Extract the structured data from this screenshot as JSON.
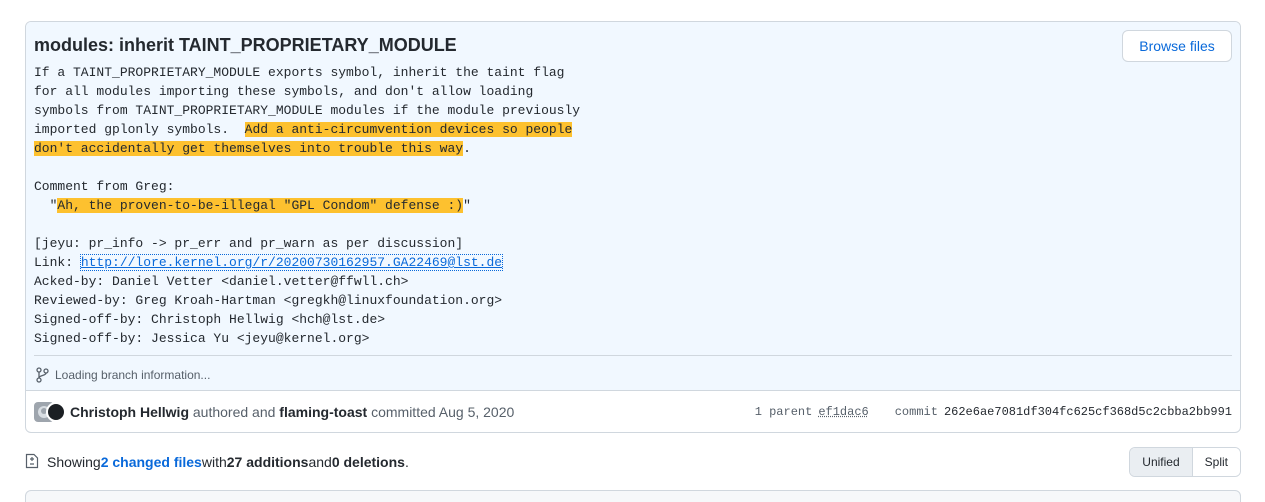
{
  "commit": {
    "title": "modules: inherit TAINT_PROPRIETARY_MODULE",
    "browse_files_label": "Browse files",
    "desc": {
      "l1": "If a TAINT_PROPRIETARY_MODULE exports symbol, inherit the taint flag",
      "l2": "for all modules importing these symbols, and don't allow loading",
      "l3": "symbols from TAINT_PROPRIETARY_MODULE modules if the module previously",
      "l4a": "imported gplonly symbols.  ",
      "l4b": "Add a anti-circumvention devices so people",
      "l5a": "don't accidentally get themselves into trouble this way",
      "l5b": ".",
      "l7": "Comment from Greg:",
      "l8a": "  \"",
      "l8b": "Ah, the proven-to-be-illegal \"GPL Condom\" defense :)",
      "l8c": "\"",
      "l10": "[jeyu: pr_info -> pr_err and pr_warn as per discussion]",
      "link_label": "Link: ",
      "link_url": "http://lore.kernel.org/r/20200730162957.GA22469@lst.de",
      "l12": "Acked-by: Daniel Vetter <daniel.vetter@ffwll.ch>",
      "l13": "Reviewed-by: Greg Kroah-Hartman <gregkh@linuxfoundation.org>",
      "l14": "Signed-off-by: Christoph Hellwig <hch@lst.de>",
      "l15": "Signed-off-by: Jessica Yu <jeyu@kernel.org>"
    },
    "branch_info": "Loading branch information...",
    "meta": {
      "author": "Christoph Hellwig",
      "authored_text": " authored and ",
      "committer": "flaming-toast",
      "committed_text": " committed ",
      "date": "Aug 5, 2020",
      "parent_label": "1 parent",
      "parent_sha": "ef1dac6",
      "commit_label": "commit",
      "commit_sha": "262e6ae7081df304fc625cf368d5c2cbba2bb991"
    }
  },
  "toolbar": {
    "showing": "Showing ",
    "changed_files": "2 changed files",
    "with": " with ",
    "additions": "27 additions",
    "and": " and ",
    "deletions": "0 deletions",
    "period": ".",
    "unified_label": "Unified",
    "split_label": "Split"
  },
  "colors": {
    "accent": "#0969da",
    "highlight": "#fdc12f",
    "header_bg": "#f1f8ff"
  },
  "icons": {
    "branch": "git-branch-icon",
    "file_diff": "file-diff-icon"
  }
}
